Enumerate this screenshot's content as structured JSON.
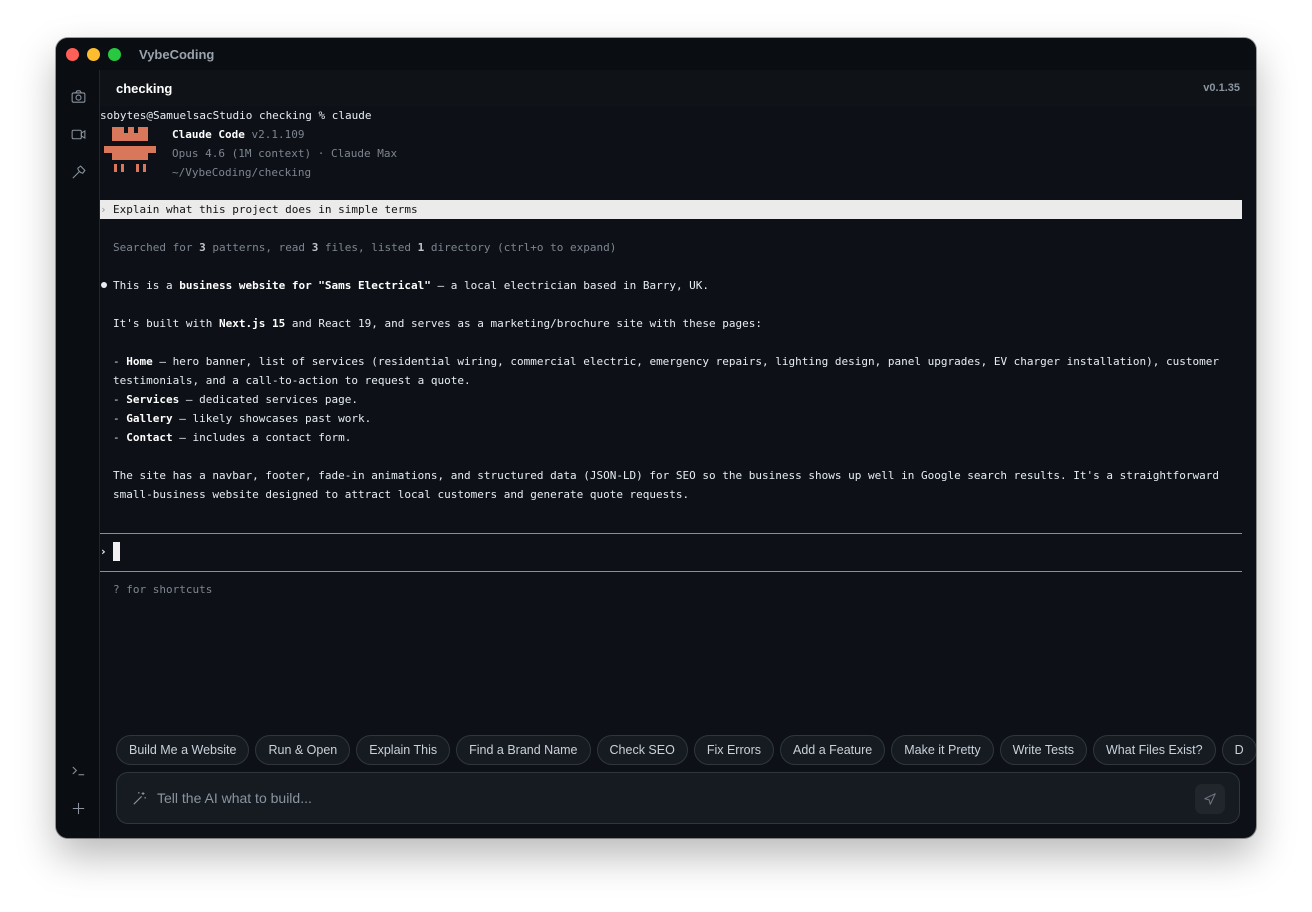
{
  "window": {
    "title": "VybeCoding"
  },
  "sidebar": {
    "top_icons": [
      "camera-icon",
      "video-icon",
      "hammer-icon"
    ],
    "bottom_icons": [
      "terminal-icon",
      "plus-icon"
    ]
  },
  "tab": {
    "title": "checking",
    "version": "v0.1.35"
  },
  "terminal": {
    "shell_command": "sobytes@SamuelsacStudio checking % claude",
    "header": {
      "name": "Claude Code",
      "version": "v2.1.109",
      "model": "Opus 4.6 (1M context) · Claude Max",
      "path": "~/VybeCoding/checking"
    },
    "user_prompt_symbol": "›",
    "user_prompt": "Explain what this project does in simple terms",
    "searched": {
      "a": "Searched for ",
      "b": "3",
      "c": " patterns, read ",
      "d": "3",
      "e": " files, listed ",
      "f": "1",
      "g": " directory (ctrl+o to expand)"
    },
    "intro": {
      "a": "This is a ",
      "b": "business website for \"Sams Electrical\"",
      "c": " — a local electrician based in Barry, UK."
    },
    "built": {
      "a": "It's built with ",
      "b": "Next.js 15",
      "c": " and React 19, and serves as a marketing/brochure site with these pages:"
    },
    "pages": [
      {
        "dash": "- ",
        "name": "Home",
        "desc": " — hero banner, list of services (residential wiring, commercial electric, emergency repairs, lighting design, panel upgrades, EV charger installation), customer"
      },
      {
        "dash": "- ",
        "name": "Services",
        "desc": " — dedicated services page."
      },
      {
        "dash": "- ",
        "name": "Gallery",
        "desc": " — likely showcases past work."
      },
      {
        "dash": "- ",
        "name": "Contact",
        "desc": " — includes a contact form."
      }
    ],
    "home_cont": "testimonials, and a call-to-action to request a quote.",
    "summary_1": "The site has a navbar, footer, fade-in animations, and structured data (JSON-LD) for SEO so the business shows up well in Google search results. It's a straightforward",
    "summary_2": "small-business website designed to attract local customers and generate quote requests.",
    "input_prompt": "›",
    "shortcuts_hint": "? for shortcuts"
  },
  "quick_actions": [
    "Build Me a Website",
    "Run & Open",
    "Explain This",
    "Find a Brand Name",
    "Check SEO",
    "Fix Errors",
    "Add a Feature",
    "Make it Pretty",
    "Write Tests",
    "What Files Exist?",
    "D"
  ],
  "input": {
    "placeholder": "Tell the AI what to build..."
  },
  "colors": {
    "logo": "#d9775a",
    "background": "#0d1117",
    "highlight": "#ebebeb"
  }
}
